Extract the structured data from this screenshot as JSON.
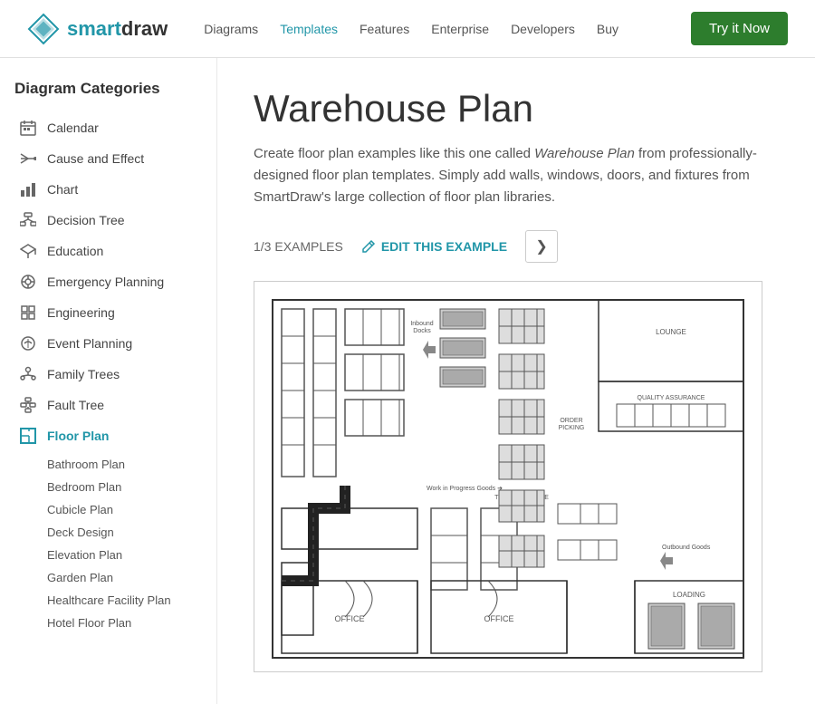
{
  "header": {
    "logo_smart": "smart",
    "logo_draw": "draw",
    "nav": [
      {
        "label": "Diagrams",
        "active": false
      },
      {
        "label": "Templates",
        "active": true
      },
      {
        "label": "Features",
        "active": false
      },
      {
        "label": "Enterprise",
        "active": false
      },
      {
        "label": "Developers",
        "active": false
      },
      {
        "label": "Buy",
        "active": false
      }
    ],
    "try_button": "Try it Now"
  },
  "sidebar": {
    "title": "Diagram Categories",
    "items": [
      {
        "label": "Calendar",
        "icon": "calendar"
      },
      {
        "label": "Cause and Effect",
        "icon": "cause-effect"
      },
      {
        "label": "Chart",
        "icon": "chart"
      },
      {
        "label": "Decision Tree",
        "icon": "decision-tree"
      },
      {
        "label": "Education",
        "icon": "education"
      },
      {
        "label": "Emergency Planning",
        "icon": "emergency"
      },
      {
        "label": "Engineering",
        "icon": "engineering"
      },
      {
        "label": "Event Planning",
        "icon": "event"
      },
      {
        "label": "Family Trees",
        "icon": "family"
      },
      {
        "label": "Fault Tree",
        "icon": "fault"
      },
      {
        "label": "Floor Plan",
        "icon": "floor-plan",
        "active": true
      }
    ],
    "sub_items": [
      "Bathroom Plan",
      "Bedroom Plan",
      "Cubicle Plan",
      "Deck Design",
      "Elevation Plan",
      "Garden Plan",
      "Healthcare Facility Plan",
      "Hotel Floor Plan"
    ]
  },
  "main": {
    "title": "Warehouse Plan",
    "description_parts": [
      "Create floor plan examples like this one called ",
      "Warehouse Plan",
      " from professionally-designed floor plan templates. Simply add walls, windows, doors, and fixtures from SmartDraw's large collection of floor plan libraries."
    ],
    "example_count": "1/3 EXAMPLES",
    "edit_label": "EDIT THIS EXAMPLE",
    "next_arrow": "❯"
  }
}
